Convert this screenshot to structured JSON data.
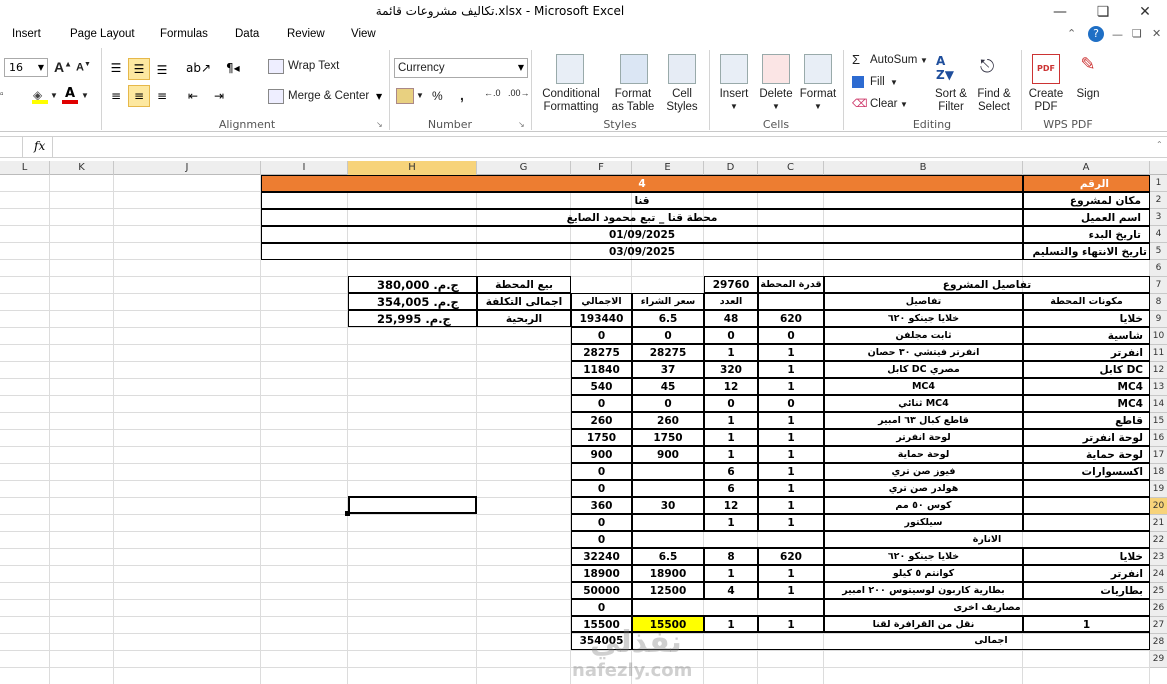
{
  "window": {
    "title": "تكاليف مشروعات قائمة.xlsx - Microsoft Excel"
  },
  "menu": [
    "Insert",
    "Page Layout",
    "Formulas",
    "Data",
    "Review",
    "View"
  ],
  "ribbon": {
    "font_size": "16",
    "wrap_text": "Wrap Text",
    "merge_center": "Merge & Center",
    "number_format": "Currency",
    "percent": "%",
    "comma": ",",
    "conditional_formatting": [
      "Conditional",
      "Formatting"
    ],
    "format_as_table": [
      "Format",
      "as Table"
    ],
    "cell_styles": [
      "Cell",
      "Styles"
    ],
    "insert": "Insert",
    "delete": "Delete",
    "format": "Format",
    "autosum": "AutoSum",
    "fill": "Fill",
    "clear": "Clear",
    "sort_filter": [
      "Sort &",
      "Filter"
    ],
    "find_select": [
      "Find &",
      "Select"
    ],
    "create_pdf": [
      "Create",
      "PDF"
    ],
    "sign": "Sign",
    "groups": {
      "alignment": "Alignment",
      "number": "Number",
      "styles": "Styles",
      "cells": "Cells",
      "editing": "Editing",
      "wps_pdf": "WPS PDF"
    }
  },
  "formula": {
    "fx": "fx",
    "value": ""
  },
  "columns": [
    "L",
    "K",
    "J",
    "I",
    "H",
    "G",
    "F",
    "E",
    "D",
    "C",
    "B",
    "A"
  ],
  "rows": [
    "1",
    "2",
    "3",
    "4",
    "5",
    "6",
    "7",
    "8",
    "9",
    "10",
    "11",
    "12",
    "13",
    "14",
    "15",
    "16",
    "17",
    "18",
    "19",
    "20",
    "21",
    "22",
    "23",
    "24",
    "25",
    "26",
    "27",
    "28",
    "29"
  ],
  "header": {
    "num_label": "الرقم",
    "num_value": "4",
    "location_label": "مكان لمشروع",
    "location_value": "قنا",
    "client_label": "اسم العميل",
    "client_value": "محطة قنا _ تبع محمود الصايغ",
    "start_label": "تاريخ البدء",
    "start_value": "01/09/2025",
    "end_label": "تاريخ الانتهاء والتسليم",
    "end_value": "03/09/2025"
  },
  "summary": {
    "rows": [
      {
        "label": "بيع المحطة",
        "value": "ج.م. 380,000"
      },
      {
        "label": "اجمالى التكلفة",
        "value": "ج.م. 354,005"
      },
      {
        "label": "الربحية",
        "value": "ج.م. 25,995"
      }
    ]
  },
  "details": {
    "title": "تفاصيل المشروع",
    "capacity_label": "قدرة المحطة",
    "capacity_value": "29760",
    "col_components": "مكونات المحطة",
    "col_details": "تفاصيل",
    "col_count": "العدد",
    "col_price": "سعر الشراء",
    "col_total": "الاجمالي",
    "items": [
      {
        "a": "خلايا",
        "b": "خلايا جينكو ٦٢٠",
        "c": "620",
        "d": "48",
        "e": "6.5",
        "f": "193440"
      },
      {
        "a": "شاسية",
        "b": "ثابت مجلفن",
        "c": "0",
        "d": "0",
        "e": "0",
        "f": "0"
      },
      {
        "a": "انفرتر",
        "b": "انفرتر فيتشي ٣٠ حصان",
        "c": "1",
        "d": "1",
        "e": "28275",
        "f": "28275"
      },
      {
        "a": "كابل DC",
        "b": "كابل DC مصري",
        "c": "1",
        "d": "320",
        "e": "37",
        "f": "11840"
      },
      {
        "a": "MC4",
        "b": "MC4",
        "c": "1",
        "d": "12",
        "e": "45",
        "f": "540"
      },
      {
        "a": "MC4",
        "b": "ثنائي MC4",
        "c": "0",
        "d": "0",
        "e": "0",
        "f": "0"
      },
      {
        "a": "قاطع",
        "b": "قاطع كبال ٦٣ امبير",
        "c": "1",
        "d": "1",
        "e": "260",
        "f": "260"
      },
      {
        "a": "لوحة انفرتر",
        "b": "لوحة انفرتر",
        "c": "1",
        "d": "1",
        "e": "1750",
        "f": "1750"
      },
      {
        "a": "لوحة حماية",
        "b": "لوحة حماية",
        "c": "1",
        "d": "1",
        "e": "900",
        "f": "900"
      },
      {
        "a": "اكسسوارات",
        "b": "فيوز صن تري",
        "c": "1",
        "d": "6",
        "e": "",
        "f": "0"
      },
      {
        "a": "",
        "b": "هولدر صن تري",
        "c": "1",
        "d": "6",
        "e": "",
        "f": "0"
      },
      {
        "a": "",
        "b": "كوس ٥٠ مم",
        "c": "1",
        "d": "12",
        "e": "30",
        "f": "360"
      },
      {
        "a": "",
        "b": "سيلكتور",
        "c": "1",
        "d": "1",
        "e": "",
        "f": "0"
      }
    ],
    "lighting_label": "الانارة",
    "lighting_total": "0",
    "lighting": [
      {
        "a": "خلايا",
        "b": "خلايا جينكو ٦٢٠",
        "c": "620",
        "d": "8",
        "e": "6.5",
        "f": "32240"
      },
      {
        "a": "انفرتر",
        "b": "كوانتم ٥ كيلو",
        "c": "1",
        "d": "1",
        "e": "18900",
        "f": "18900"
      },
      {
        "a": "بطاريات",
        "b": "بطارية كاربون لوسيتوس ٢٠٠ امبير",
        "c": "1",
        "d": "4",
        "e": "12500",
        "f": "50000"
      }
    ],
    "other_label": "مصاريف اخرى",
    "other_total": "0",
    "transport": {
      "a": "1",
      "b": "نقل من القرافرة لقنا",
      "c": "1",
      "d": "1",
      "e": "15500",
      "f": "15500"
    },
    "total_label": "اجمالى",
    "total_value": "354005"
  },
  "watermark": "nafezly.com"
}
